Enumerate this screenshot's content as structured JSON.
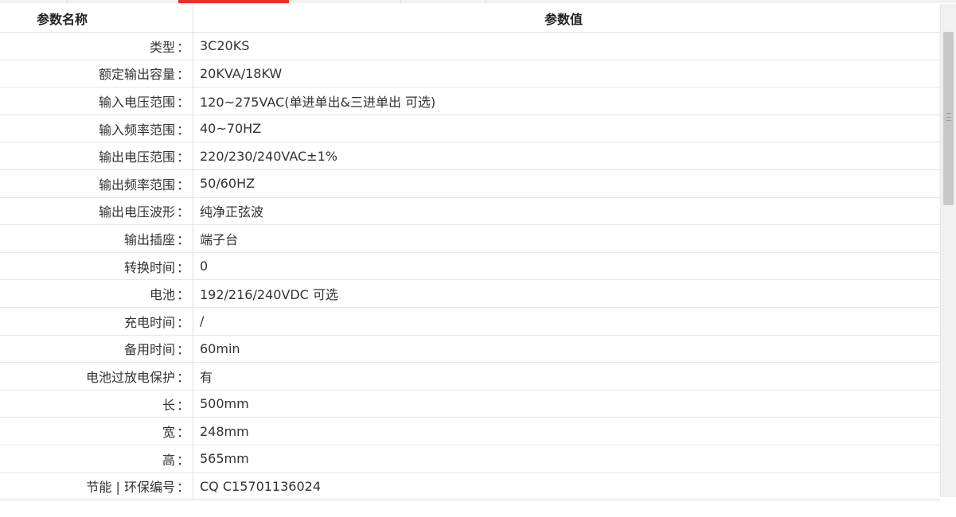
{
  "header": {
    "name_col": "参数名称",
    "value_col": "参数值"
  },
  "separator": "：",
  "rows": [
    {
      "label": "类型",
      "value": "3C20KS"
    },
    {
      "label": "额定输出容量",
      "value": "20KVA/18KW"
    },
    {
      "label": "输入电压范围",
      "value": "120~275VAC(单进单出&三进单出 可选)"
    },
    {
      "label": "输入频率范围",
      "value": "40~70HZ"
    },
    {
      "label": "输出电压范围",
      "value": "220/230/240VAC±1%"
    },
    {
      "label": "输出频率范围",
      "value": "50/60HZ"
    },
    {
      "label": "输出电压波形",
      "value": "纯净正弦波"
    },
    {
      "label": "输出插座",
      "value": "端子台"
    },
    {
      "label": "转换时间",
      "value": "0"
    },
    {
      "label": "电池",
      "value": "192/216/240VDC 可选"
    },
    {
      "label": "充电时间",
      "value": "/"
    },
    {
      "label": "备用时间",
      "value": "60min"
    },
    {
      "label": "电池过放电保护",
      "value": "有"
    },
    {
      "label": "长",
      "value": "500mm"
    },
    {
      "label": "宽",
      "value": "248mm"
    },
    {
      "label": "高",
      "value": "565mm"
    },
    {
      "label": "节能 | 环保编号",
      "value": "CQ C15701136024"
    }
  ],
  "colors": {
    "active_tab": "#e8322c",
    "border": "#e0e0e0"
  }
}
